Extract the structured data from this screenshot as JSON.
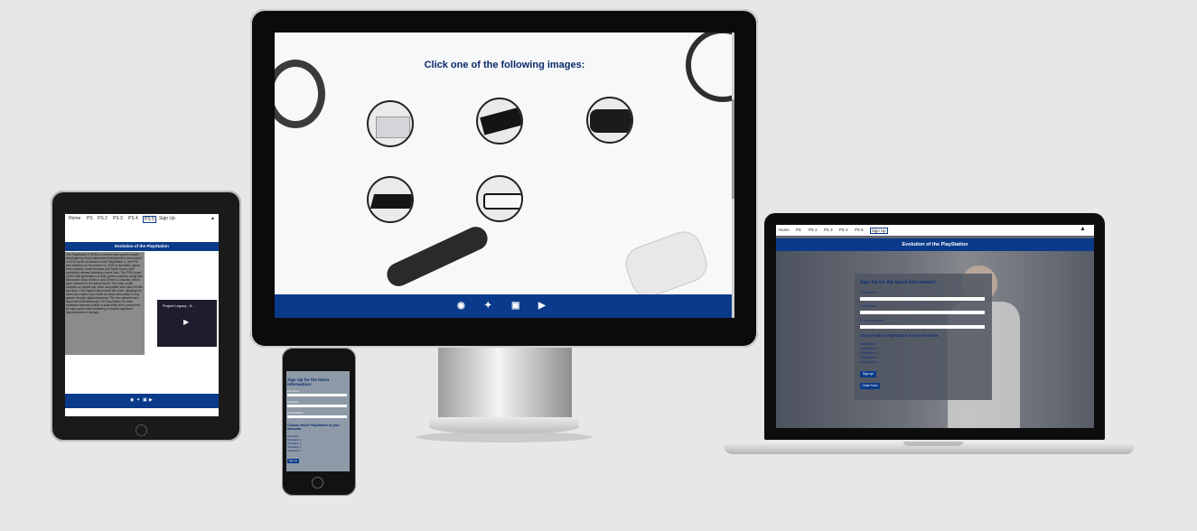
{
  "desktop": {
    "heading": "Click one of the following images:",
    "images": [
      {
        "name": "PS1 console",
        "color": "#cfd0d4"
      },
      {
        "name": "PS2 console",
        "color": "#111111"
      },
      {
        "name": "PS3 console",
        "color": "#1c1c1c"
      },
      {
        "name": "PS4 console",
        "color": "#151515"
      },
      {
        "name": "PS5 console",
        "color": "#f5f5f5"
      }
    ],
    "social_icons": [
      "facebook-icon",
      "twitter-icon",
      "instagram-icon",
      "youtube-icon"
    ],
    "footer_color": "#0a3a8a"
  },
  "tablet": {
    "nav": [
      "Home",
      "PS",
      "PS 2",
      "PS 3",
      "PS 4",
      "PS 5",
      "Sign Up"
    ],
    "active_nav": "PS 5",
    "hero": "Evolution of the PlayStation",
    "body_text": "The PlayStation 5 (PS5) is a home video game console developed by Sony Interactive Entertainment. Announced in 2019 as the successor to the PlayStation 4, the PS5 was released on November 12, 2020 in Australia, Japan, New Zealand, North America and South Korea, with worldwide release following a week later. The PS5 is part of the ninth generation of video game consoles, along with Microsoft's Xbox Series X and Series S consoles, which were released in the same month. The base model includes an optical disc drive compatible with Ultra HD Blu-ray discs. The Digital Edition lacks this drive, allowing it to serve as a lower-cost model for those who prefer to buy games through digital download. The two variants were launched simultaneously. The PlayStation 5's main hardware features include a solid-state drive customized for high-speed data streaming to enable significant improvements in storage.",
    "video_title": "Project Legacy - 5..."
  },
  "phone": {
    "title": "Sign Up for the latest information!",
    "fields": [
      "First Name",
      "Last Name",
      "E-mail Address"
    ],
    "favourite_title": "Choose which PlayStation is your favourite:",
    "options": [
      "PlayStation",
      "PlayStation 2",
      "PlayStation 3",
      "PlayStation 4",
      "PlayStation 5"
    ],
    "submit": "Sign up!"
  },
  "laptop": {
    "nav": [
      "Home",
      "PS",
      "PS 2",
      "PS 3",
      "PS 4",
      "PS 5",
      "Sign Up"
    ],
    "active_nav": "Sign Up",
    "hero": "Evolution of the PlayStation",
    "form": {
      "title": "Sign Up for the latest information!",
      "fields": [
        "First Name",
        "Last Name",
        "E-mail Address"
      ],
      "favourite_title": "Choose which PlayStation is your favourite:",
      "options": [
        "PlayStation",
        "PlayStation 2",
        "PlayStation 3",
        "PlayStation 4",
        "PlayStation 5"
      ],
      "submit": "Sign up!",
      "clear": "Clear Form"
    }
  }
}
